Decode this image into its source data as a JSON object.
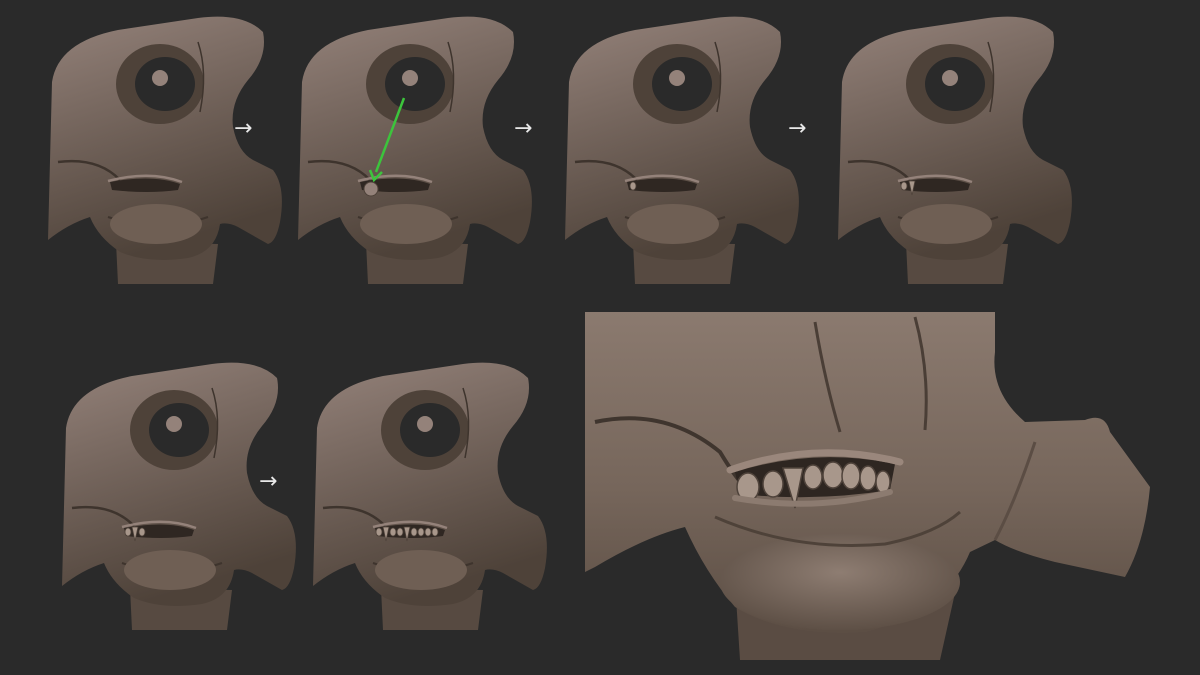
{
  "page": {
    "background": "#2a2a2a"
  },
  "colors": {
    "clay": "#7a6a5e",
    "clay_light": "#94827a",
    "clay_dark": "#4e4239",
    "crease": "#3e342d",
    "guide_arrow": "#3cc43c",
    "step_arrow": "#e8e8e8"
  },
  "steps": [
    {
      "step": 1,
      "teeth": "none",
      "sphere": false,
      "guide_arrow": false
    },
    {
      "step": 2,
      "teeth": "none",
      "sphere": true,
      "guide_arrow": true
    },
    {
      "step": 3,
      "teeth": "one",
      "sphere": false,
      "guide_arrow": false
    },
    {
      "step": 4,
      "teeth": "two",
      "sphere": false,
      "guide_arrow": false
    },
    {
      "step": 5,
      "teeth": "few",
      "sphere": false,
      "guide_arrow": false
    },
    {
      "step": 6,
      "teeth": "full",
      "sphere": false,
      "guide_arrow": false
    }
  ],
  "icons": {
    "step_arrow": "right-arrow-icon",
    "guide_arrow": "green-arrow-icon"
  },
  "arrow_glyph": "→"
}
